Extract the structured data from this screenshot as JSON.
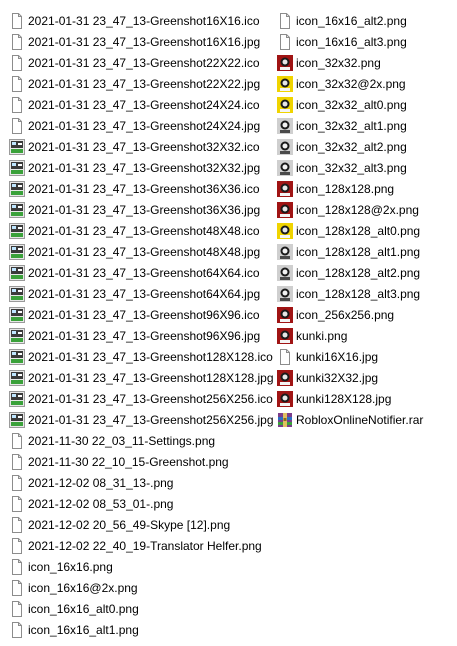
{
  "colors": {
    "background": "#ffffff",
    "text": "#000000",
    "page_outline": "#8c8c8c",
    "greenshot_green": "#3aa13a",
    "greenshot_screen": "#3a3a3a",
    "roblox_red": "#a01414",
    "roblox_yellow": "#f0d400",
    "rar_purple": "#7a3d8c"
  },
  "files": {
    "column_left": [
      {
        "name": "2021-01-31 23_47_13-Greenshot16X16.ico",
        "icon": "blank-file-icon"
      },
      {
        "name": "2021-01-31 23_47_13-Greenshot16X16.jpg",
        "icon": "blank-file-icon"
      },
      {
        "name": "2021-01-31 23_47_13-Greenshot22X22.ico",
        "icon": "blank-file-icon"
      },
      {
        "name": "2021-01-31 23_47_13-Greenshot22X22.jpg",
        "icon": "blank-file-icon"
      },
      {
        "name": "2021-01-31 23_47_13-Greenshot24X24.ico",
        "icon": "blank-file-icon"
      },
      {
        "name": "2021-01-31 23_47_13-Greenshot24X24.jpg",
        "icon": "blank-file-icon"
      },
      {
        "name": "2021-01-31 23_47_13-Greenshot32X32.ico",
        "icon": "greenshot-thumbnail-icon"
      },
      {
        "name": "2021-01-31 23_47_13-Greenshot32X32.jpg",
        "icon": "greenshot-thumbnail-icon"
      },
      {
        "name": "2021-01-31 23_47_13-Greenshot36X36.ico",
        "icon": "greenshot-thumbnail-icon"
      },
      {
        "name": "2021-01-31 23_47_13-Greenshot36X36.jpg",
        "icon": "greenshot-thumbnail-icon"
      },
      {
        "name": "2021-01-31 23_47_13-Greenshot48X48.ico",
        "icon": "greenshot-thumbnail-icon"
      },
      {
        "name": "2021-01-31 23_47_13-Greenshot48X48.jpg",
        "icon": "greenshot-thumbnail-icon"
      },
      {
        "name": "2021-01-31 23_47_13-Greenshot64X64.ico",
        "icon": "greenshot-thumbnail-icon"
      },
      {
        "name": "2021-01-31 23_47_13-Greenshot64X64.jpg",
        "icon": "greenshot-thumbnail-icon"
      },
      {
        "name": "2021-01-31 23_47_13-Greenshot96X96.ico",
        "icon": "greenshot-thumbnail-icon"
      },
      {
        "name": "2021-01-31 23_47_13-Greenshot96X96.jpg",
        "icon": "greenshot-thumbnail-icon"
      },
      {
        "name": "2021-01-31 23_47_13-Greenshot128X128.ico",
        "icon": "greenshot-thumbnail-icon"
      },
      {
        "name": "2021-01-31 23_47_13-Greenshot128X128.jpg",
        "icon": "greenshot-thumbnail-icon"
      },
      {
        "name": "2021-01-31 23_47_13-Greenshot256X256.ico",
        "icon": "greenshot-thumbnail-icon"
      },
      {
        "name": "2021-01-31 23_47_13-Greenshot256X256.jpg",
        "icon": "greenshot-thumbnail-icon"
      },
      {
        "name": "2021-11-30 22_03_11-Settings.png",
        "icon": "blank-file-icon"
      },
      {
        "name": "2021-11-30 22_10_15-Greenshot.png",
        "icon": "blank-file-icon"
      },
      {
        "name": "2021-12-02 08_31_13-.png",
        "icon": "blank-file-icon"
      },
      {
        "name": "2021-12-02 08_53_01-.png",
        "icon": "blank-file-icon"
      },
      {
        "name": "2021-12-02 20_56_49-Skype [12].png",
        "icon": "blank-file-icon"
      },
      {
        "name": "2021-12-02 22_40_19-Translator Helfer.png",
        "icon": "blank-file-icon"
      },
      {
        "name": "icon_16x16.png",
        "icon": "blank-file-icon"
      },
      {
        "name": "icon_16x16@2x.png",
        "icon": "blank-file-icon"
      },
      {
        "name": "icon_16x16_alt0.png",
        "icon": "blank-file-icon"
      },
      {
        "name": "icon_16x16_alt1.png",
        "icon": "blank-file-icon"
      }
    ],
    "column_right": [
      {
        "name": "icon_16x16_alt2.png",
        "icon": "blank-file-icon"
      },
      {
        "name": "icon_16x16_alt3.png",
        "icon": "blank-file-icon"
      },
      {
        "name": "icon_32x32.png",
        "icon": "roblox-red-icon"
      },
      {
        "name": "icon_32x32@2x.png",
        "icon": "roblox-yellow-icon"
      },
      {
        "name": "icon_32x32_alt0.png",
        "icon": "roblox-yellow-icon"
      },
      {
        "name": "icon_32x32_alt1.png",
        "icon": "roblox-gray-icon"
      },
      {
        "name": "icon_32x32_alt2.png",
        "icon": "roblox-gray-icon"
      },
      {
        "name": "icon_32x32_alt3.png",
        "icon": "roblox-gray-icon"
      },
      {
        "name": "icon_128x128.png",
        "icon": "roblox-red-icon"
      },
      {
        "name": "icon_128x128@2x.png",
        "icon": "roblox-red-icon"
      },
      {
        "name": "icon_128x128_alt0.png",
        "icon": "roblox-yellow-icon"
      },
      {
        "name": "icon_128x128_alt1.png",
        "icon": "roblox-gray-icon"
      },
      {
        "name": "icon_128x128_alt2.png",
        "icon": "roblox-gray-icon"
      },
      {
        "name": "icon_128x128_alt3.png",
        "icon": "roblox-gray-icon"
      },
      {
        "name": "icon_256x256.png",
        "icon": "roblox-red-icon"
      },
      {
        "name": "kunki.png",
        "icon": "roblox-red-icon"
      },
      {
        "name": "kunki16X16.jpg",
        "icon": "blank-file-icon"
      },
      {
        "name": "kunki32X32.jpg",
        "icon": "roblox-red-icon"
      },
      {
        "name": "kunki128X128.jpg",
        "icon": "roblox-red-icon"
      },
      {
        "name": "RobloxOnlineNotifier.rar",
        "icon": "rar-archive-icon"
      }
    ]
  }
}
